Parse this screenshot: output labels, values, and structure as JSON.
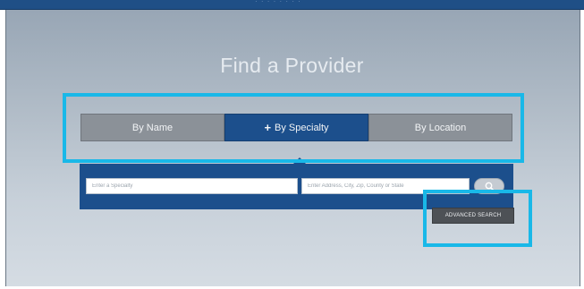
{
  "header": {
    "top_bar_text": "· · · · · · · ·"
  },
  "hero": {
    "title": "Find a Provider"
  },
  "tabs": [
    {
      "label": "By Name",
      "active": false
    },
    {
      "label": "By Specialty",
      "active": true,
      "icon": "plus-icon"
    },
    {
      "label": "By Location",
      "active": false
    }
  ],
  "search": {
    "specialty_placeholder": "Enter a Specialty",
    "specialty_value": "",
    "address_placeholder": "Enter Address, City, Zip, County or State",
    "address_value": "",
    "search_button_icon": "search-icon"
  },
  "advanced_search": {
    "label": "ADVANCED SEARCH"
  },
  "colors": {
    "brand_blue": "#1c4f8c",
    "tab_gray": "#8b9198",
    "highlight_cyan": "#19b8e8",
    "advanced_button": "#4d5156"
  }
}
